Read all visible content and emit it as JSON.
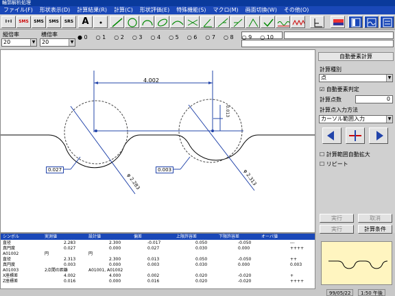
{
  "app": {
    "title": "輪郭解析処理"
  },
  "menu": [
    "ファイル(F)",
    "形状表示(D)",
    "計算結果(R)",
    "計算(C)",
    "形状評価(E)",
    "特殊機能(S)",
    "マクロ(M)",
    "画面切換(W)",
    "その他(O)"
  ],
  "toolbar": {
    "text_tools": [
      "I+I",
      "SMS",
      "SMS",
      "SMS",
      "SRS",
      "A"
    ]
  },
  "scale": {
    "x_label": "縦倍率",
    "x_value": "20",
    "y_label": "横倍率",
    "y_value": "20"
  },
  "radios": {
    "options": [
      "0",
      "1",
      "2",
      "3",
      "4",
      "5",
      "6",
      "7",
      "8",
      "9",
      "10"
    ],
    "selected": "0"
  },
  "drawing": {
    "dim_top": "4.002",
    "dim_small": "0.013",
    "label_left": "0.027",
    "label_right": "0.003",
    "dia_left": "φ 2.283",
    "dia_right": "φ 2.313"
  },
  "panel": {
    "title": "自動要素計算",
    "calc_type_label": "計算種別",
    "calc_type_value": "点",
    "auto_judge": "自動要素判定",
    "points_label": "計算点数",
    "points_value": "0",
    "input_label": "計算点入力方法",
    "input_value": "カーソル範囲入力",
    "auto_expand": "計算範囲自動拡大",
    "repeat": "リピート",
    "btn_a": "実行",
    "btn_b": "取消",
    "btn_c": "実行",
    "btn_d": "計算条件"
  },
  "table": {
    "headers": [
      "シンボル",
      "実測値",
      "設計値",
      "偏差",
      "上限許容差",
      "下限許容差",
      "オーバ値"
    ],
    "rows": [
      [
        "直径",
        "2.283",
        "2.300",
        "-0.017",
        "0.050",
        "-0.050",
        "---"
      ],
      [
        "真円度",
        "0.027",
        "0.000",
        "0.027",
        "0.030",
        "0.000",
        "++++"
      ],
      [
        "A01002",
        "円",
        "円",
        "",
        "",
        "",
        ""
      ],
      [
        "直径",
        "2.313",
        "2.300",
        "0.013",
        "0.050",
        "-0.050",
        "++"
      ],
      [
        "真円度",
        "0.003",
        "0.000",
        "0.003",
        "0.030",
        "0.000",
        "0.003"
      ],
      [
        "A01003",
        "2点間の距離",
        "A01001, A01002",
        "",
        "",
        "",
        ""
      ],
      [
        "X座標差",
        "4.002",
        "4.000",
        "0.002",
        "0.020",
        "-0.020",
        "+"
      ],
      [
        "Z座標差",
        "0.016",
        "0.000",
        "0.016",
        "0.020",
        "-0.020",
        "++++"
      ]
    ]
  },
  "status": {
    "date": "99/05/22",
    "time": "1:50 午後"
  }
}
